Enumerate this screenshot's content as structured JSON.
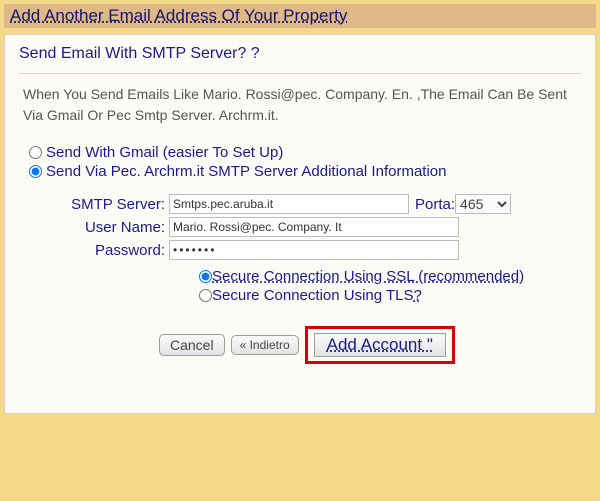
{
  "title": "Add Another Email Address Of Your Property",
  "heading": "Send Email With SMTP Server?",
  "description": "When You Send Emails Like Mario. Rossi@pec. Company. En. ,The Email Can Be Sent Via Gmail Or Pec Smtp Server. Archrm.it.",
  "sendMethod": {
    "gmail_label": "Send With Gmail (easier To Set Up)",
    "smtp_label": "Send Via Pec. Archrm.it SMTP Server Additional Information"
  },
  "form": {
    "smtp_label": "SMTP Server:",
    "smtp_value": "Smtps.pec.aruba.it",
    "port_label": "Porta:",
    "port_value": "465",
    "user_label": "User Name:",
    "user_value": "Mario. Rossi@pec. Company. It",
    "pass_label": "Password:",
    "pass_value": "•••••••"
  },
  "security": {
    "ssl_label": "Secure Connection Using SSL (recommended)",
    "tls_label": "Secure Connection Using TLS"
  },
  "buttons": {
    "cancel": "Cancel",
    "back": "« Indietro",
    "add": "Add Account \""
  }
}
